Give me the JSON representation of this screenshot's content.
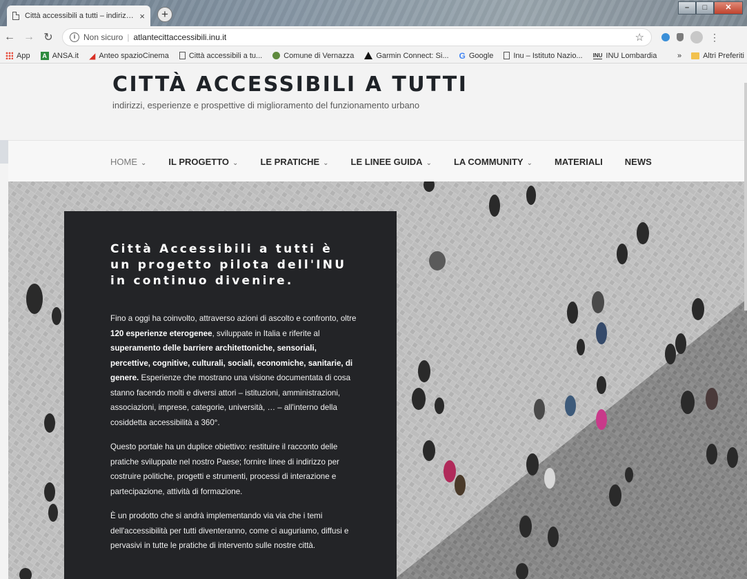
{
  "browser": {
    "tab_title": "Città accessibili a tutti – indirizzi, esperienze",
    "tab_close": "×",
    "new_tab": "+",
    "security_label": "Non sicuro",
    "url": "atlantecittaccessibili.inu.it",
    "bookmarks": [
      {
        "label": "App",
        "icon": "apps-grid-icon"
      },
      {
        "label": "ANSA.it",
        "icon": "ansa-icon"
      },
      {
        "label": "Anteo spazioCinema",
        "icon": "anteo-icon"
      },
      {
        "label": "Città accessibili a tu...",
        "icon": "page-icon"
      },
      {
        "label": "Comune di Vernazza",
        "icon": "vernazza-icon"
      },
      {
        "label": "Garmin Connect: Si...",
        "icon": "garmin-icon"
      },
      {
        "label": "Google",
        "icon": "google-icon"
      },
      {
        "label": "Inu – Istituto Nazio...",
        "icon": "page-icon"
      },
      {
        "label": "INU Lombardia",
        "icon": "inu-icon"
      }
    ],
    "bookmarks_overflow": "»",
    "other_bookmarks": "Altri Preferiti"
  },
  "site": {
    "title": "CITTÀ ACCESSIBILI A TUTTI",
    "tagline": "indirizzi, esperienze e prospettive di miglioramento del funzionamento urbano"
  },
  "nav": {
    "items": [
      {
        "label": "HOME",
        "dropdown": true
      },
      {
        "label": "IL PROGETTO",
        "dropdown": true
      },
      {
        "label": "LE PRATICHE",
        "dropdown": true
      },
      {
        "label": "LE LINEE GUIDA",
        "dropdown": true
      },
      {
        "label": "LA COMMUNITY",
        "dropdown": true
      },
      {
        "label": "MATERIALI",
        "dropdown": false
      },
      {
        "label": "NEWS",
        "dropdown": false
      }
    ],
    "chevron": "⌄"
  },
  "hero": {
    "heading": "Città Accessibili a tutti è un progetto pilota dell'INU in continuo divenire.",
    "p1_a": "Fino a oggi ha coinvolto, attraverso azioni di ascolto e confronto, oltre ",
    "p1_b": "120 esperienze eterogenee",
    "p1_c": ", sviluppate in Italia e riferite al ",
    "p1_d": "superamento delle barriere architettoniche, sensoriali, percettive, cognitive, culturali, sociali, economiche, sanitarie, di genere.",
    "p1_e": " Esperienze che mostrano una visione documentata di cosa stanno facendo molti e diversi attori – istituzioni, amministrazioni, associazioni, imprese, categorie, università, … – all'interno della cosiddetta accessibilità a 360°.",
    "p2": "Questo portale ha un duplice obiettivo: restituire il racconto delle pratiche sviluppate nel nostro Paese; fornire linee di indirizzo per costruire politiche, progetti e strumenti, processi di interazione e partecipazione, attività di formazione.",
    "p3": "È un prodotto che si andrà implementando via via che i temi dell'accessibilità per tutti diventeranno, come ci auguriamo, diffusi e pervasivi in tutte le pratiche di intervento sulle nostre città."
  },
  "colors": {
    "panel": "#232427",
    "title": "#1f2328",
    "page_bg": "#f3f3f3"
  }
}
